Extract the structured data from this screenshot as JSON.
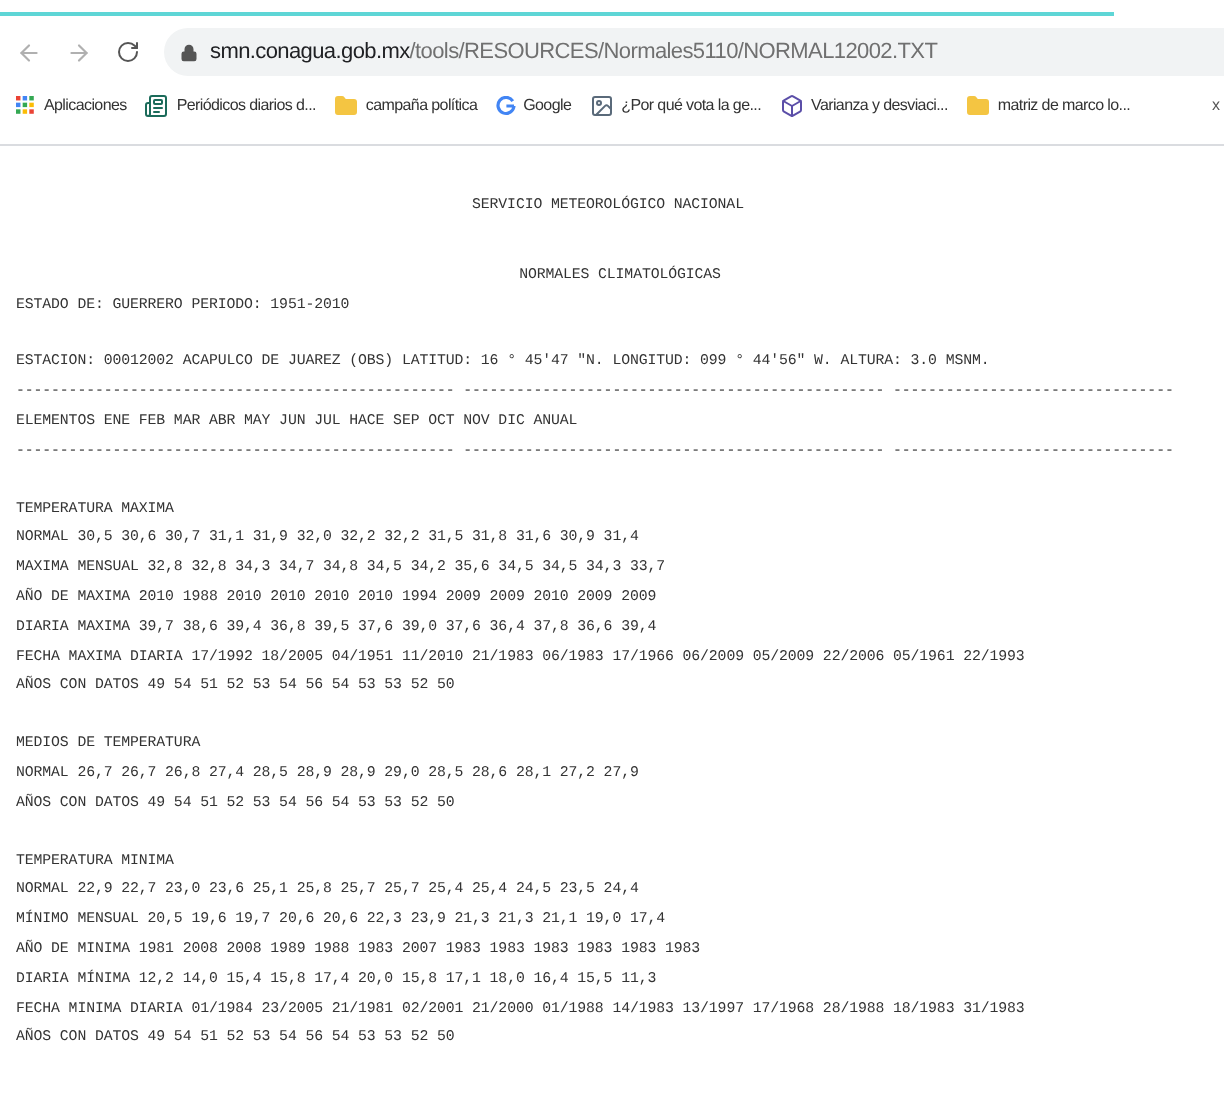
{
  "browser": {
    "loading": {
      "level": 0.91
    },
    "url": {
      "host": "smn.conagua.gob.mx",
      "path": "/tools/RESOURCES/Normales5110/NORMAL12002.TXT"
    },
    "bookmarks": [
      {
        "kind": "apps",
        "label": "Aplicaciones"
      },
      {
        "kind": "site",
        "label": "Periódicos diarios d..."
      },
      {
        "kind": "folder",
        "label": "campaña política"
      },
      {
        "kind": "google",
        "label": "Google"
      },
      {
        "kind": "page",
        "label": "¿Por qué vota la ge..."
      },
      {
        "kind": "cube",
        "label": "Varianza y desviaci..."
      },
      {
        "kind": "folder",
        "label": "matriz de marco lo..."
      }
    ],
    "bookmarks_overflow": "x"
  },
  "document": {
    "title_lines": [
      "SERVICIO METEOROLÓGICO NACIONAL",
      "NORMALES CLIMATOLÓGICAS"
    ],
    "blocks": [
      {
        "lines": [
          "ESTADO DE: GUERRERO PERIODO: 1951-2010"
        ]
      },
      {
        "lines": [
          "ESTACION: 00012002 ACAPULCO DE JUAREZ (OBS) LATITUD: 16 ° 45'47 \"N. LONGITUD: 099 ° 44'56\" W. ALTURA: 3.0 MSNM.",
          "-------------------------------------------------- ------------------------------------------------ --------------------------------",
          "ELEMENTOS ENE FEB MAR ABR MAY JUN JUL HACE SEP OCT NOV DIC ANUAL",
          "-------------------------------------------------- ------------------------------------------------ --------------------------------"
        ]
      },
      {
        "lines": [
          "TEMPERATURA MAXIMA",
          "NORMAL 30,5 30,6 30,7 31,1 31,9 32,0 32,2 32,2 31,5 31,8 31,6 30,9 31,4",
          "MAXIMA MENSUAL 32,8 32,8 34,3 34,7 34,8 34,5 34,2 35,6 34,5 34,5 34,3 33,7",
          "AÑO DE MAXIMA 2010 1988 2010 2010 2010 2010 1994 2009 2009 2010 2009 2009",
          "DIARIA MAXIMA 39,7 38,6 39,4 36,8 39,5 37,6 39,0 37,6 36,4 37,8 36,6 39,4",
          "FECHA MAXIMA DIARIA 17/1992 18/2005 04/1951 11/2010 21/1983 06/1983 17/1966 06/2009 05/2009 22/2006 05/1961 22/1993",
          "AÑOS CON DATOS 49 54 51 52 53 54 56 54 53 53 52 50"
        ]
      },
      {
        "lines": [
          "MEDIOS DE TEMPERATURA",
          "NORMAL 26,7 26,7 26,8 27,4 28,5 28,9 28,9 29,0 28,5 28,6 28,1 27,2 27,9",
          "AÑOS CON DATOS 49 54 51 52 53 54 56 54 53 53 52 50"
        ]
      },
      {
        "lines": [
          "TEMPERATURA MINIMA",
          "NORMAL 22,9 22,7 23,0 23,6 25,1 25,8 25,7 25,7 25,4 25,4 24,5 23,5 24,4",
          "MÍNIMO MENSUAL 20,5 19,6 19,7 20,6 20,6 22,3 23,9 21,3 21,3 21,1 19,0 17,4",
          "AÑO DE MINIMA 1981 2008 2008 1989 1988 1983 2007 1983 1983 1983 1983 1983 1983",
          "DIARIA MÍNIMA 12,2 14,0 15,4 15,8 17,4 20,0 15,8 17,1 18,0 16,4 15,5 11,3",
          "FECHA MINIMA DIARIA 01/1984 23/2005 21/1981 02/2001 21/2000 01/1988 14/1983 13/1997 17/1968 28/1988 18/1983 31/1983",
          "AÑOS CON DATOS 49 54 51 52 53 54 56 54 53 53 52 50"
        ]
      }
    ]
  }
}
